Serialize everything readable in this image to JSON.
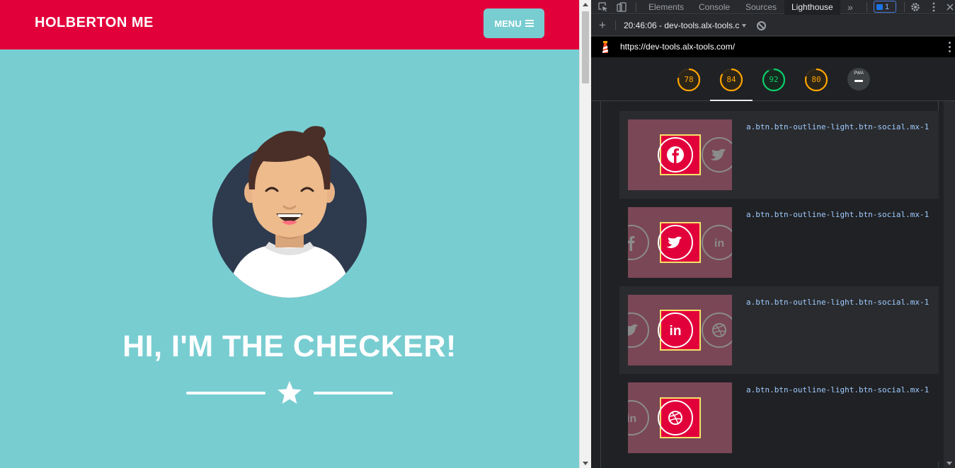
{
  "page": {
    "brand": "HOLBERTON ME",
    "menu_label": "MENU",
    "hero_title": "HI, I'M THE CHECKER!"
  },
  "devtools": {
    "tabs": [
      {
        "label": "Elements"
      },
      {
        "label": "Console"
      },
      {
        "label": "Sources"
      },
      {
        "label": "Lighthouse"
      }
    ],
    "active_tab": "Lighthouse",
    "issues_count": "1",
    "report_label": "20:46:06 - dev-tools.alx-tools.c",
    "url": "https://dev-tools.alx-tools.com/",
    "scores": [
      {
        "value": "78",
        "color": "#ffa400"
      },
      {
        "value": "84",
        "color": "#ffa400"
      },
      {
        "value": "92",
        "color": "#0cce6b"
      },
      {
        "value": "80",
        "color": "#ffa400"
      }
    ],
    "pwa_label": "PWA",
    "audit_rows": [
      {
        "selector": "a.btn.btn-outline-light.btn-social.mx-1",
        "icon": "facebook-icon"
      },
      {
        "selector": "a.btn.btn-outline-light.btn-social.mx-1",
        "icon": "twitter-icon"
      },
      {
        "selector": "a.btn.btn-outline-light.btn-social.mx-1",
        "icon": "linkedin-icon"
      },
      {
        "selector": "a.btn.btn-outline-light.btn-social.mx-1",
        "icon": "dribbble-icon"
      }
    ]
  },
  "colors": {
    "navbar": "#e2003b",
    "page_bg": "#78cdd1",
    "devtools_bg": "#202124",
    "highlight": "#f5e06a"
  }
}
